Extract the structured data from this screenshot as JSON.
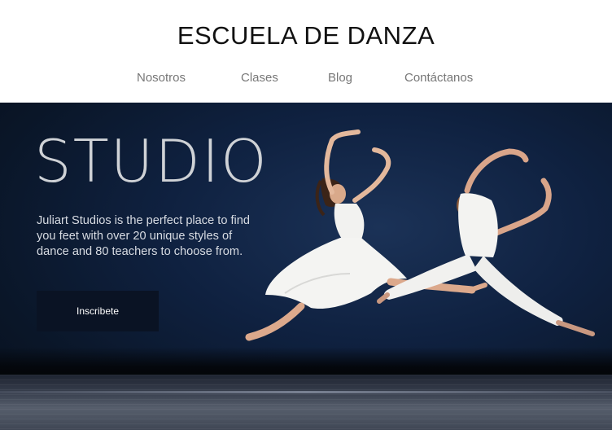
{
  "header": {
    "site_title": "ESCUELA DE DANZA",
    "nav": [
      "Nosotros",
      "Clases",
      "Blog",
      "Contáctanos"
    ]
  },
  "hero": {
    "heading": "STUDIO",
    "description": "Juliart Studios is the perfect place to find you feet with over 20 unique styles of dance and 80 teachers to choose from.",
    "cta_label": "Inscribete"
  }
}
